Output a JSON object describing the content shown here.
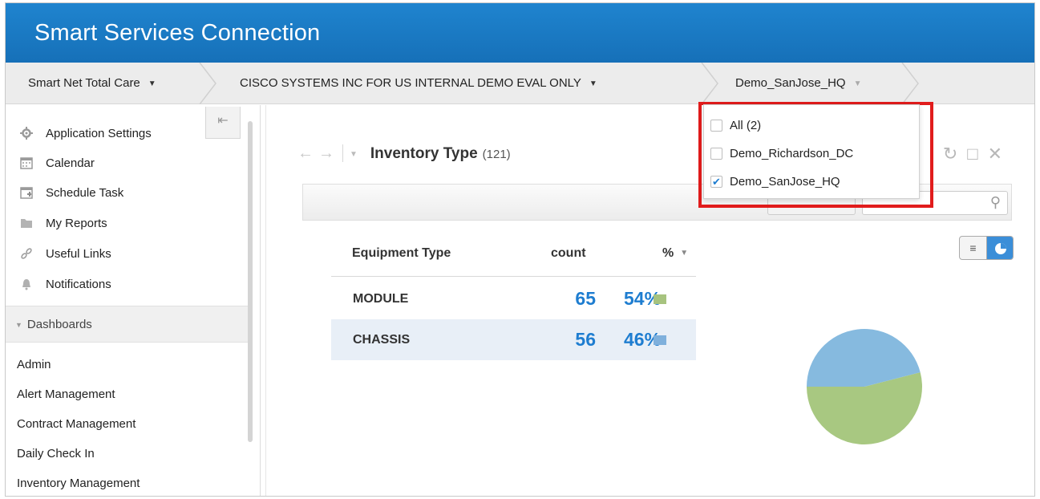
{
  "app": {
    "title": "Smart Services Connection"
  },
  "breadcrumb": [
    {
      "label": "Smart Net Total Care"
    },
    {
      "label": "CISCO SYSTEMS INC FOR US INTERNAL DEMO EVAL ONLY"
    },
    {
      "label": "Demo_SanJose_HQ"
    }
  ],
  "sidebar": {
    "items": [
      {
        "label": "Application Settings",
        "icon": "gear-icon"
      },
      {
        "label": "Calendar",
        "icon": "calendar-icon"
      },
      {
        "label": "Schedule Task",
        "icon": "schedule-icon"
      },
      {
        "label": "My Reports",
        "icon": "folder-icon"
      },
      {
        "label": "Useful Links",
        "icon": "link-icon"
      },
      {
        "label": "Notifications",
        "icon": "bell-icon"
      }
    ],
    "dashboards_header": "Dashboards",
    "dashboards": [
      {
        "label": "Admin"
      },
      {
        "label": "Alert Management"
      },
      {
        "label": "Contract Management"
      },
      {
        "label": "Daily Check In"
      },
      {
        "label": "Inventory Management"
      }
    ]
  },
  "panel": {
    "title": "Inventory Type",
    "count": "(121)",
    "table": {
      "headers": [
        "Equipment Type",
        "count",
        "%"
      ],
      "rows": [
        {
          "type": "MODULE",
          "count": "65",
          "pct": "54%",
          "color": "#a7c37f"
        },
        {
          "type": "CHASSIS",
          "count": "56",
          "pct": "46%",
          "color": "#7fb0dc"
        }
      ]
    },
    "pie": {
      "slices": [
        {
          "label": "MODULE",
          "value": 54,
          "color": "#a8c881"
        },
        {
          "label": "CHASSIS",
          "value": 46,
          "color": "#86badf"
        }
      ]
    }
  },
  "site_dropdown": {
    "options": [
      {
        "label": "All (2)",
        "checked": false
      },
      {
        "label": "Demo_Richardson_DC",
        "checked": false
      },
      {
        "label": "Demo_SanJose_HQ",
        "checked": true
      }
    ]
  },
  "colors": {
    "header": "#1670b8",
    "accent": "#1e7dd0",
    "highlight": "#e11c1c"
  }
}
